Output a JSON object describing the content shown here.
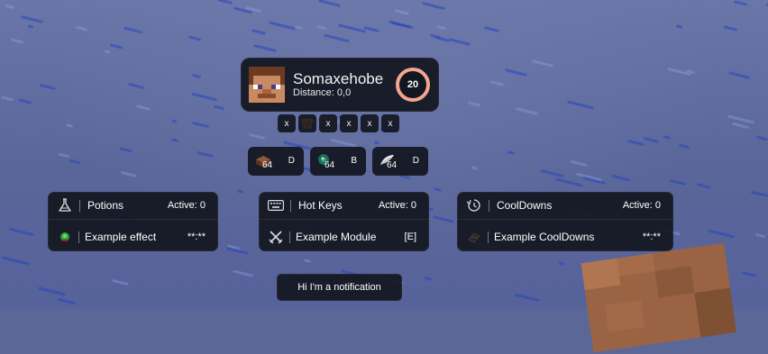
{
  "target": {
    "name": "Somaxehobe",
    "distance": "Distance: 0,0",
    "health": "20"
  },
  "armor_slots": [
    "x",
    "",
    "x",
    "x",
    "x",
    "x"
  ],
  "items": [
    {
      "icon": "block-icon",
      "count": "64",
      "key": "D"
    },
    {
      "icon": "ender-pearl-icon",
      "count": "64",
      "key": "B"
    },
    {
      "icon": "feather-icon",
      "count": "64",
      "key": "D"
    }
  ],
  "modules": {
    "potions": {
      "title": "Potions",
      "active": "Active: 0",
      "entry": "Example effect",
      "entry_value": "**:**"
    },
    "hotkeys": {
      "title": "Hot Keys",
      "active": "Active: 0",
      "entry": "Example Module",
      "entry_value": "[E]"
    },
    "cooldowns": {
      "title": "CoolDowns",
      "active": "Active: 0",
      "entry": "Example CoolDowns",
      "entry_value": "**:**"
    }
  },
  "notification": "Hi I'm a notification",
  "colors": {
    "panel": "#12161f",
    "accent_ring": "#f2a58f",
    "background": "#5b6797"
  }
}
